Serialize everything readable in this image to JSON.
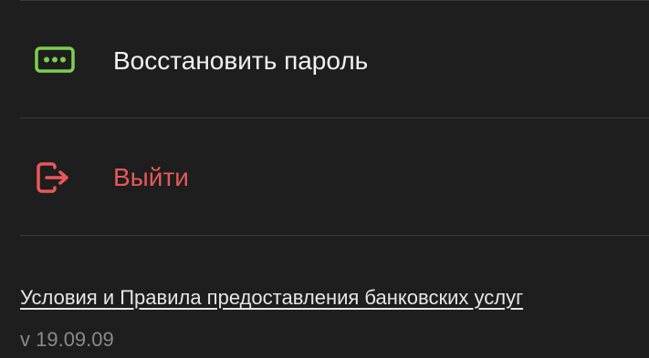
{
  "menu": {
    "items": [
      {
        "label": "Восстановить пароль",
        "icon": "password-dots-icon",
        "color": "#f2f2f2",
        "icon_color": "#7ccf4f"
      },
      {
        "label": "Выйти",
        "icon": "logout-icon",
        "color": "#e8585a",
        "icon_color": "#e8585a"
      }
    ]
  },
  "footer": {
    "terms_link": "Условия и Правила предоставления банковских услуг",
    "version": "v 19.09.09"
  },
  "colors": {
    "background": "#1e1e1e",
    "divider": "#3a3a3a",
    "accent_green": "#7ccf4f",
    "danger_red": "#e8585a"
  }
}
